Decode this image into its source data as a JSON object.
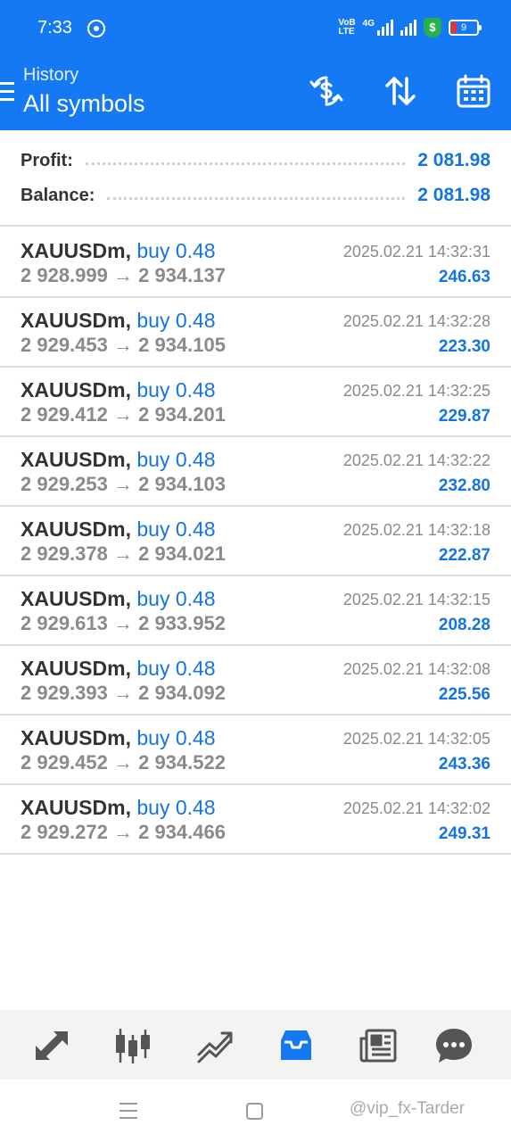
{
  "status_bar": {
    "time": "7:33",
    "network_text_top": "VoB",
    "network_text_bottom": "LTE",
    "signal_text": "4G",
    "battery_level": "9",
    "shield_symbol": "$"
  },
  "header": {
    "subtitle": "History",
    "title": "All symbols",
    "color": "#1479f2"
  },
  "summary": {
    "profit_label": "Profit:",
    "profit_value": "2 081.98",
    "balance_label": "Balance:",
    "balance_value": "2 081.98"
  },
  "deals": [
    {
      "symbol": "XAUUSDm,",
      "type": "buy 0.48",
      "prices": "2 928.999 → 2 934.137",
      "time": "2025.02.21 14:32:31",
      "profit": "246.63"
    },
    {
      "symbol": "XAUUSDm,",
      "type": "buy 0.48",
      "prices": "2 929.453 → 2 934.105",
      "time": "2025.02.21 14:32:28",
      "profit": "223.30"
    },
    {
      "symbol": "XAUUSDm,",
      "type": "buy 0.48",
      "prices": "2 929.412 → 2 934.201",
      "time": "2025.02.21 14:32:25",
      "profit": "229.87"
    },
    {
      "symbol": "XAUUSDm,",
      "type": "buy 0.48",
      "prices": "2 929.253 → 2 934.103",
      "time": "2025.02.21 14:32:22",
      "profit": "232.80"
    },
    {
      "symbol": "XAUUSDm,",
      "type": "buy 0.48",
      "prices": "2 929.378 → 2 934.021",
      "time": "2025.02.21 14:32:18",
      "profit": "222.87"
    },
    {
      "symbol": "XAUUSDm,",
      "type": "buy 0.48",
      "prices": "2 929.613 → 2 933.952",
      "time": "2025.02.21 14:32:15",
      "profit": "208.28"
    },
    {
      "symbol": "XAUUSDm,",
      "type": "buy 0.48",
      "prices": "2 929.393 → 2 934.092",
      "time": "2025.02.21 14:32:08",
      "profit": "225.56"
    },
    {
      "symbol": "XAUUSDm,",
      "type": "buy 0.48",
      "prices": "2 929.452 → 2 934.522",
      "time": "2025.02.21 14:32:05",
      "profit": "243.36"
    },
    {
      "symbol": "XAUUSDm,",
      "type": "buy 0.48",
      "prices": "2 929.272 → 2 934.466",
      "time": "2025.02.21 14:32:02",
      "profit": "249.31"
    }
  ],
  "bottom_nav": {
    "items": [
      "quotes-icon",
      "chart-icon",
      "trade-icon",
      "history-icon",
      "news-icon",
      "chat-icon"
    ],
    "active": "history-icon",
    "active_color": "#1479f2",
    "inactive_color": "#555555"
  },
  "system_nav": {
    "watermark": "@vip_fx-Tarder"
  }
}
